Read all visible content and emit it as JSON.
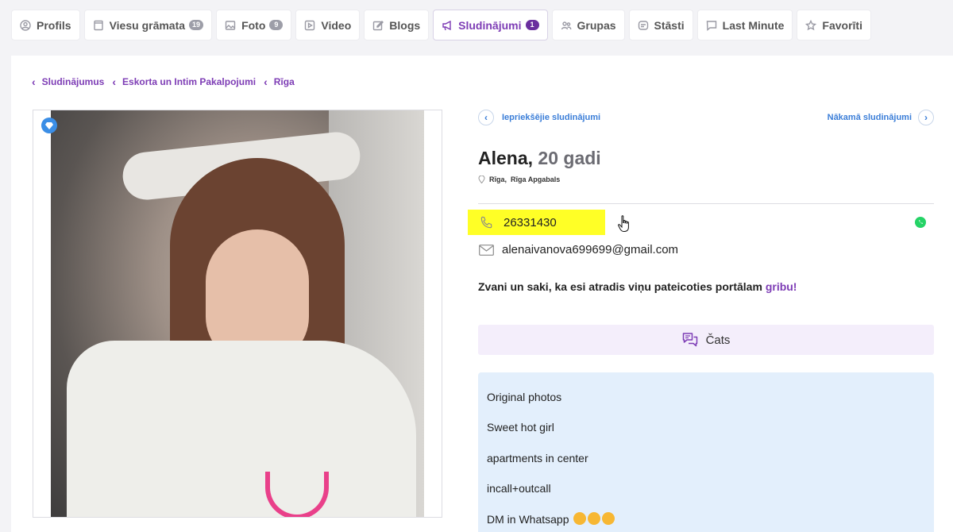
{
  "tabs": [
    {
      "icon": "user-circle-icon",
      "label": "Profils",
      "badge": ""
    },
    {
      "icon": "guestbook-icon",
      "label": "Viesu grāmata",
      "badge": "19"
    },
    {
      "icon": "image-icon",
      "label": "Foto",
      "badge": "9"
    },
    {
      "icon": "video-icon",
      "label": "Video",
      "badge": ""
    },
    {
      "icon": "pencil-icon",
      "label": "Blogs",
      "badge": ""
    },
    {
      "icon": "megaphone-icon",
      "label": "Sludinājumi",
      "badge": "1",
      "active": true
    },
    {
      "icon": "group-icon",
      "label": "Grupas",
      "badge": ""
    },
    {
      "icon": "story-icon",
      "label": "Stāsti",
      "badge": ""
    },
    {
      "icon": "chat-bubble-icon",
      "label": "Last Minute",
      "badge": ""
    },
    {
      "icon": "star-icon",
      "label": "Favorīti",
      "badge": ""
    }
  ],
  "breadcrumb": [
    "Sludinājumus",
    "Eskorta un Intim Pakalpojumi",
    "Rīga"
  ],
  "nav": {
    "prev": "Iepriekšējie sludinājumi",
    "next": "Nākamā sludinājumi"
  },
  "profile": {
    "name": "Alena,",
    "age": "20 gadi",
    "location_city": "Rīga",
    "location_sep": ",",
    "location_region": "Rīga Apgabals",
    "phone": "26331430",
    "email": "alenaivanova699699@gmail.com"
  },
  "call_to_action": {
    "text": "Zvani un saki, ka esi atradis viņu pateicoties portālam ",
    "link": "gribu!"
  },
  "chat_button": "Čats",
  "description": [
    "Original photos",
    "Sweet hot girl",
    "apartments in center",
    "incall+outcall",
    "DM in Whatsapp"
  ],
  "colors": {
    "accent": "#7d3cb5",
    "link_blue": "#3b7ed8",
    "highlight": "#ffff26",
    "whatsapp": "#25d366",
    "desc_bg": "#e3effc",
    "chat_bg": "#f4eefb"
  }
}
